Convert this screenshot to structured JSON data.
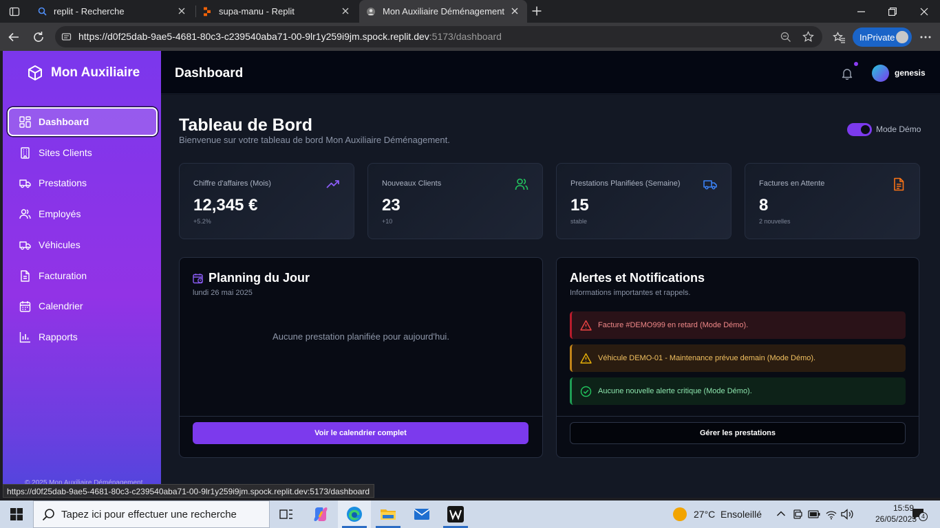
{
  "browser": {
    "tabs": [
      {
        "title": "replit - Recherche"
      },
      {
        "title": "supa-manu - Replit"
      },
      {
        "title": "Mon Auxiliaire Déménagement"
      }
    ],
    "url_host": "https://d0f25dab-9ae5-4681-80c3-c239540aba71-00-9lr1y259i9jm.spock.replit.dev",
    "url_path": ":5173/dashboard",
    "inprivate_label": "InPrivate",
    "status_link": "https://d0f25dab-9ae5-4681-80c3-c239540aba71-00-9lr1y259i9jm.spock.replit.dev:5173/dashboard"
  },
  "sidebar": {
    "brand": "Mon Auxiliaire",
    "items": [
      {
        "label": "Dashboard",
        "icon": "dashboard-icon"
      },
      {
        "label": "Sites Clients",
        "icon": "building-icon"
      },
      {
        "label": "Prestations",
        "icon": "truck-icon"
      },
      {
        "label": "Employés",
        "icon": "users-icon"
      },
      {
        "label": "Véhicules",
        "icon": "truck-icon"
      },
      {
        "label": "Facturation",
        "icon": "file-icon"
      },
      {
        "label": "Calendrier",
        "icon": "calendar-icon"
      },
      {
        "label": "Rapports",
        "icon": "bar-chart-icon"
      }
    ],
    "copyright": "© 2025 Mon Auxiliaire Déménagement"
  },
  "header": {
    "title": "Dashboard",
    "user": "genesis"
  },
  "main": {
    "title": "Tableau de Bord",
    "subtitle": "Bienvenue sur votre tableau de bord Mon Auxiliaire Déménagement.",
    "demo_label": "Mode Démo",
    "stats": [
      {
        "label": "Chiffre d'affaires (Mois)",
        "value": "12,345 €",
        "sub": "+5.2%",
        "icon": "trending-up-icon",
        "color": "#8b5cf6"
      },
      {
        "label": "Nouveaux Clients",
        "value": "23",
        "sub": "+10",
        "icon": "users-icon",
        "color": "#22c55e"
      },
      {
        "label": "Prestations Planifiées (Semaine)",
        "value": "15",
        "sub": "stable",
        "icon": "truck-icon",
        "color": "#3b82f6"
      },
      {
        "label": "Factures en Attente",
        "value": "8",
        "sub": "2 nouvelles",
        "icon": "file-text-icon",
        "color": "#f97316"
      }
    ],
    "planning": {
      "title": "Planning du Jour",
      "date": "lundi 26 mai 2025",
      "empty": "Aucune prestation planifiée pour aujourd'hui.",
      "button": "Voir le calendrier complet"
    },
    "alerts": {
      "title": "Alertes et Notifications",
      "subtitle": "Informations importantes et rappels.",
      "items": [
        {
          "text": "Facture #DEMO999 en retard (Mode Démo).",
          "level": "error"
        },
        {
          "text": "Véhicule DEMO-01 - Maintenance prévue demain (Mode Démo).",
          "level": "warning"
        },
        {
          "text": "Aucune nouvelle alerte critique (Mode Démo).",
          "level": "success"
        }
      ],
      "button": "Gérer les prestations"
    }
  },
  "taskbar": {
    "search_placeholder": "Tapez ici pour effectuer une recherche",
    "weather": "27°C  Ensoleillé",
    "time": "15:59",
    "date": "26/05/2025",
    "notifications": "4"
  }
}
